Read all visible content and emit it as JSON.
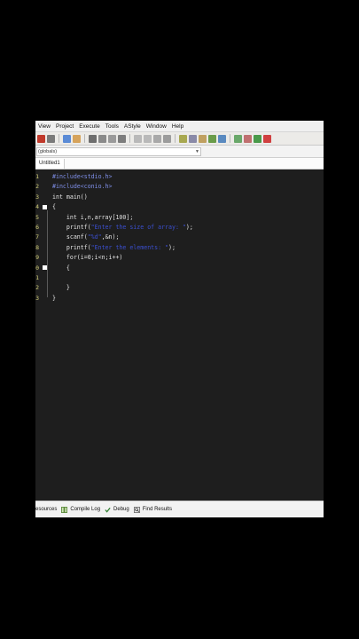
{
  "menu": [
    "View",
    "Project",
    "Execute",
    "Tools",
    "AStyle",
    "Window",
    "Help"
  ],
  "scope": {
    "value": "(globals)"
  },
  "tab": {
    "label": "Untitled1"
  },
  "editor": {
    "line_numbers": [
      "1",
      "2",
      "3",
      "4",
      "5",
      "6",
      "7",
      "8",
      "9",
      "0",
      "1",
      "2",
      "3"
    ],
    "lines": [
      [
        {
          "t": "pp",
          "v": "#include<stdio.h>"
        }
      ],
      [
        {
          "t": "pp",
          "v": "#include<conio.h>"
        }
      ],
      [
        {
          "t": "n",
          "v": "int main()"
        }
      ],
      [
        {
          "t": "n",
          "v": "{"
        }
      ],
      [
        {
          "t": "n",
          "v": "    int i,n,array[100];"
        }
      ],
      [
        {
          "t": "n",
          "v": "    printf("
        },
        {
          "t": "str",
          "v": "\"Enter the size of array: \""
        },
        {
          "t": "n",
          "v": ");"
        }
      ],
      [
        {
          "t": "n",
          "v": "    scanf("
        },
        {
          "t": "str",
          "v": "\"%d\""
        },
        {
          "t": "n",
          "v": ",&n);"
        }
      ],
      [
        {
          "t": "n",
          "v": "    printf("
        },
        {
          "t": "str",
          "v": "\"Enter the elements: \""
        },
        {
          "t": "n",
          "v": ");"
        }
      ],
      [
        {
          "t": "n",
          "v": "    for(i=0;i<n;i++)"
        }
      ],
      [
        {
          "t": "n",
          "v": "    {"
        }
      ],
      [
        {
          "t": "n",
          "v": ""
        }
      ],
      [
        {
          "t": "n",
          "v": "    }"
        }
      ],
      [
        {
          "t": "n",
          "v": "}"
        }
      ]
    ]
  },
  "status": {
    "resources": "esources",
    "compile_log": "Compile Log",
    "debug": "Debug",
    "find_results": "Find Results"
  },
  "icons": {
    "compile_log": "grid-icon",
    "debug": "check-icon",
    "find_results": "find-icon"
  }
}
